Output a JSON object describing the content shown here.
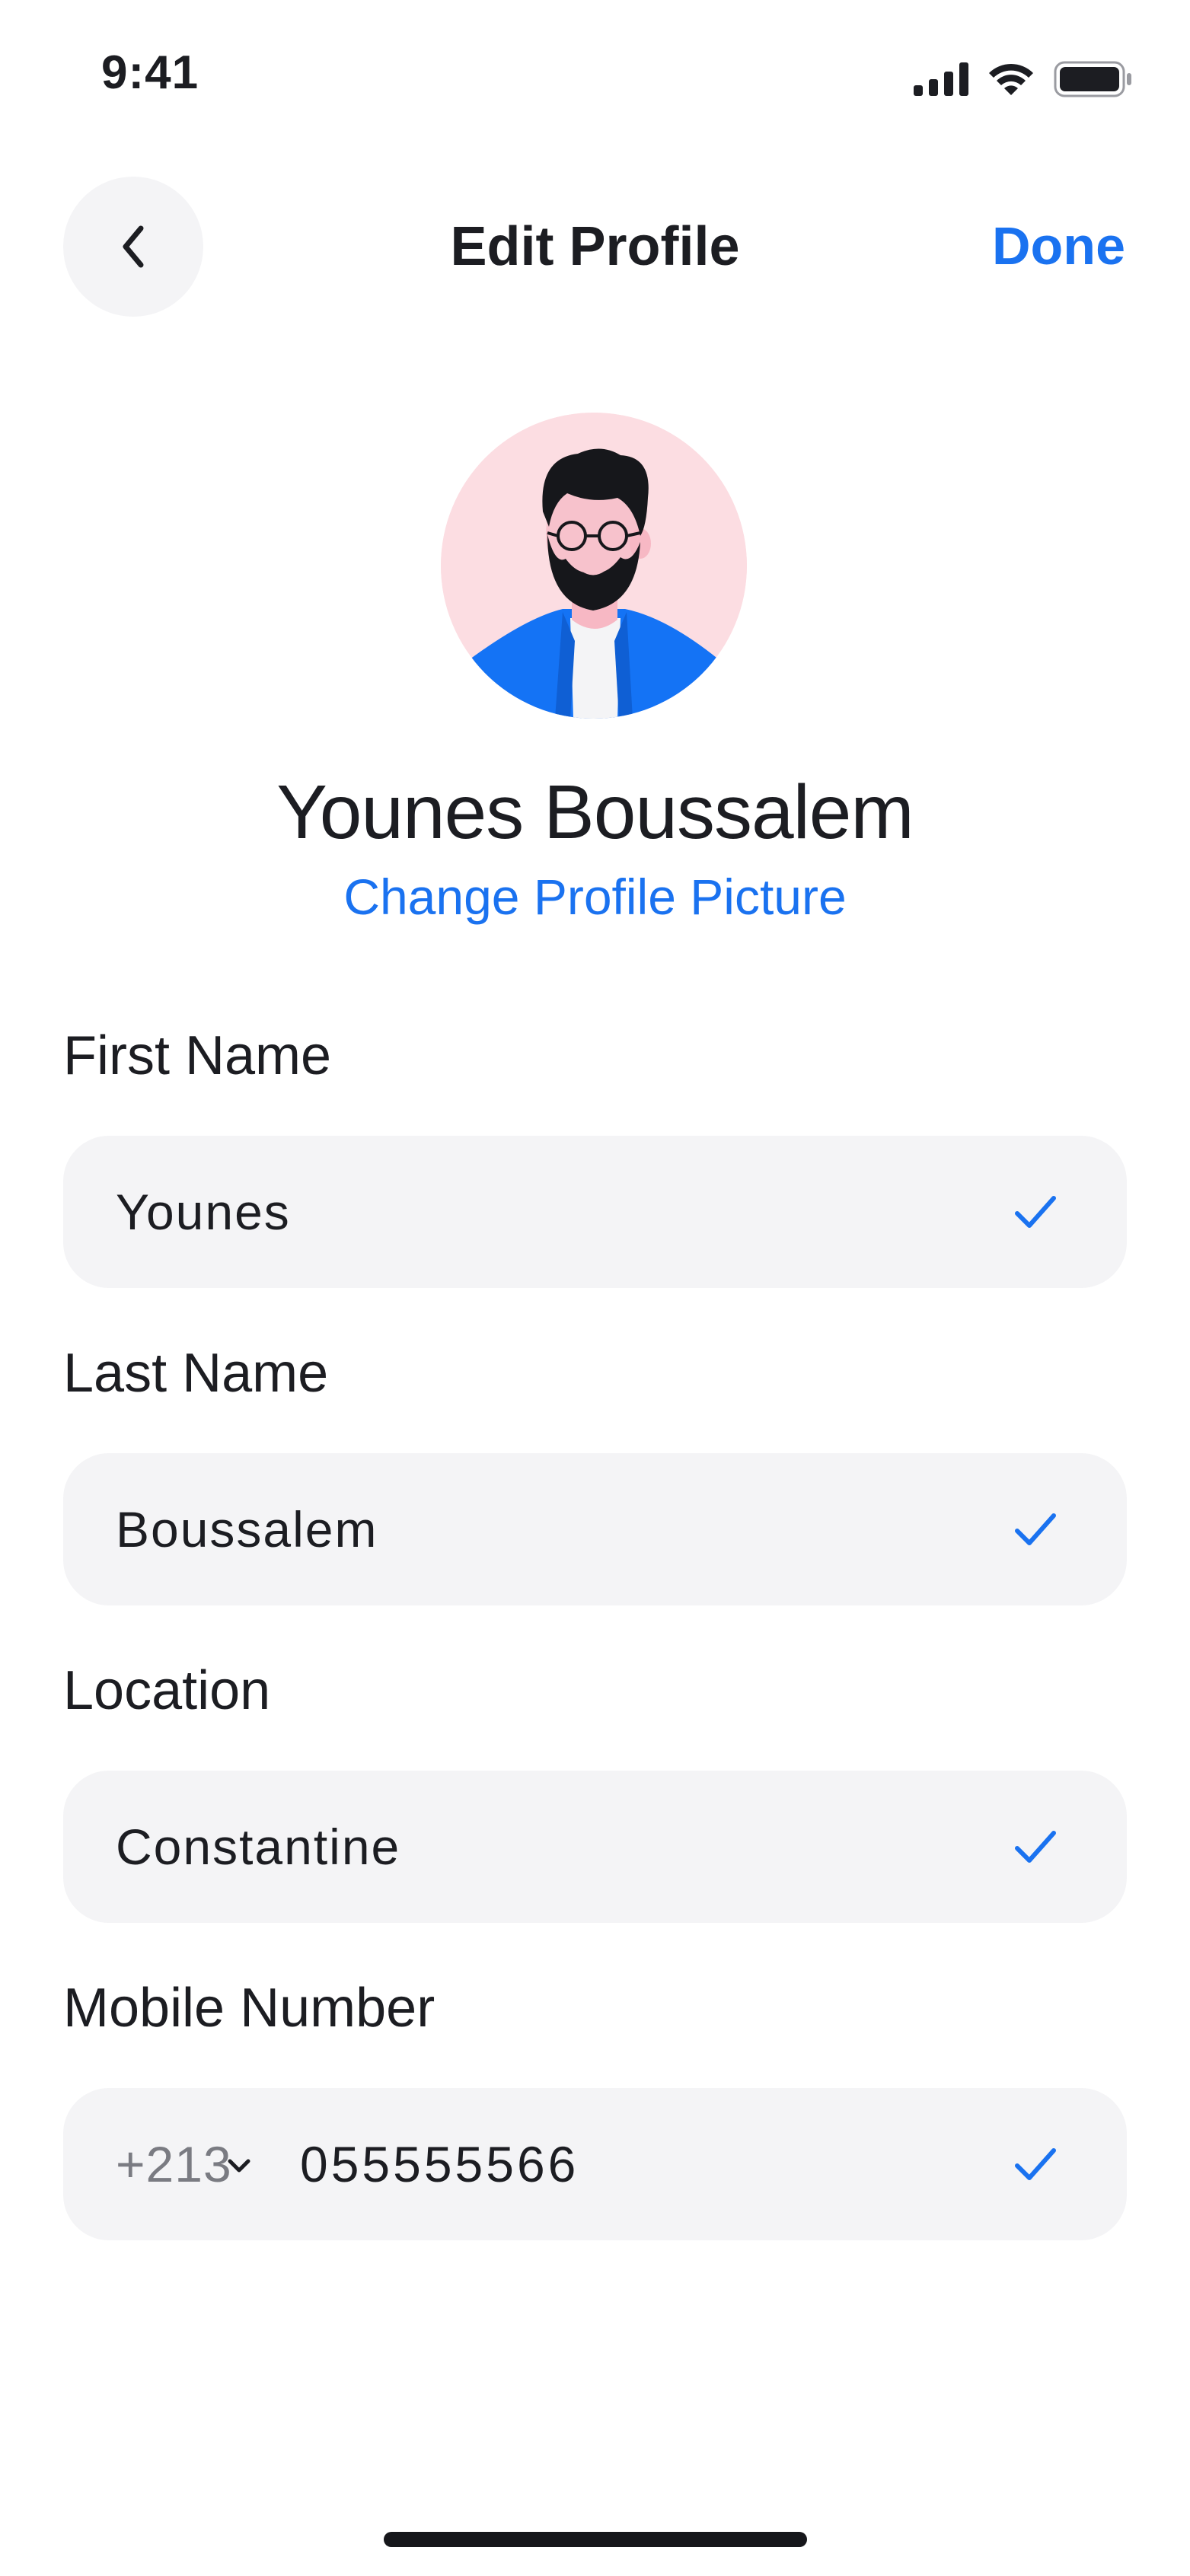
{
  "status_bar": {
    "time": "9:41",
    "icons": [
      "cellular-signal-icon",
      "wifi-icon",
      "battery-icon"
    ]
  },
  "header": {
    "back_icon": "chevron-left-icon",
    "title": "Edit Profile",
    "done_label": "Done"
  },
  "profile": {
    "avatar_icon": "user-avatar-illustration",
    "name": "Younes Boussalem",
    "change_picture_label": "Change Profile Picture"
  },
  "form": {
    "first_name": {
      "label": "First Name",
      "value": "Younes",
      "valid": true
    },
    "last_name": {
      "label": "Last Name",
      "value": "Boussalem",
      "valid": true
    },
    "location": {
      "label": "Location",
      "value": "Constantine",
      "valid": true
    },
    "mobile": {
      "label": "Mobile Number",
      "country_code": "+213",
      "number": "055555566",
      "valid": true
    }
  },
  "colors": {
    "accent": "#1a72f0",
    "text": "#1c1d22",
    "field_background": "#f4f4f6",
    "avatar_background": "#fcdde2",
    "muted": "#7a7b82"
  }
}
